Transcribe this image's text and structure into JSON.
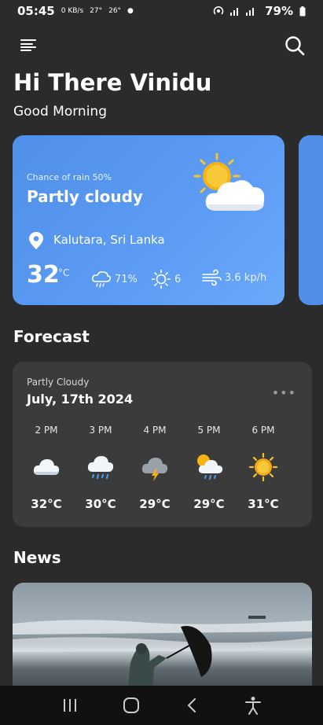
{
  "status_bar": {
    "time": "05:45",
    "net_speed": "0 KB/s",
    "temp_a": "27°",
    "temp_b": "26°",
    "battery": "79%"
  },
  "greeting": {
    "title": "Hi There Vinidu",
    "subtitle": "Good Morning"
  },
  "weather_card": {
    "rain_chance": "Chance of rain 50%",
    "condition": "Partly cloudy",
    "location": "Kalutara, Sri Lanka",
    "temperature": "32",
    "temp_unit": "°C",
    "humidity": "71%",
    "uv_index": "6",
    "wind": "3.6 kp/h"
  },
  "forecast": {
    "section_title": "Forecast",
    "condition": "Partly Cloudy",
    "date": "July, 17th 2024",
    "more": "•••",
    "hours": [
      {
        "time": "2 PM",
        "temp": "32°C",
        "icon": "cloud-icon"
      },
      {
        "time": "3 PM",
        "temp": "30°C",
        "icon": "rain-cloud-icon"
      },
      {
        "time": "4 PM",
        "temp": "29°C",
        "icon": "thunder-cloud-icon"
      },
      {
        "time": "5 PM",
        "temp": "29°C",
        "icon": "sun-rain-cloud-icon"
      },
      {
        "time": "6 PM",
        "temp": "31°C",
        "icon": "sun-icon"
      }
    ]
  },
  "news": {
    "section_title": "News"
  },
  "colors": {
    "background": "#2b2b2b",
    "card_blue": "#5c9cf5",
    "card_dark": "#3b3b3b",
    "sun": "#f5b316"
  }
}
